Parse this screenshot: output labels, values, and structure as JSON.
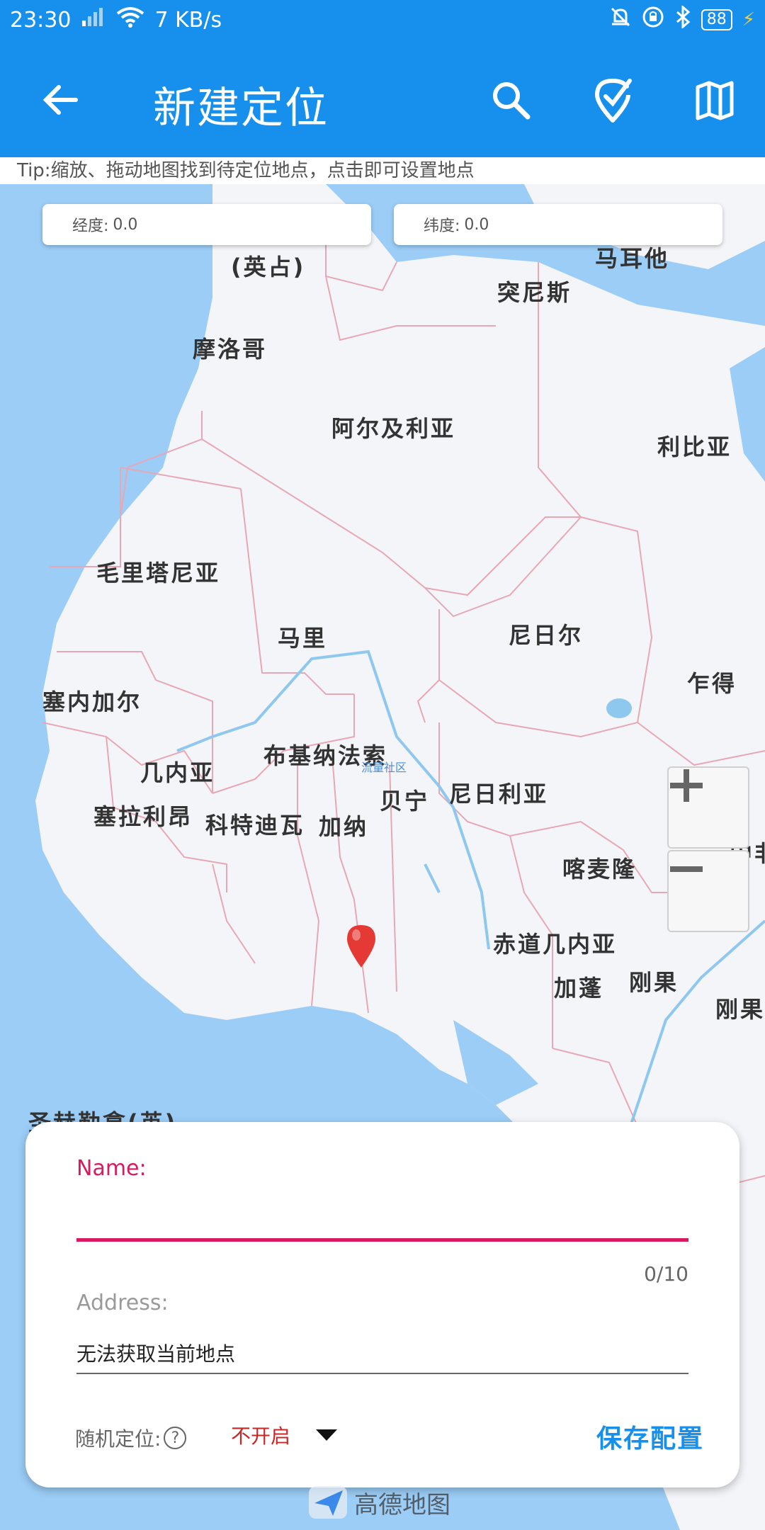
{
  "status_bar": {
    "time": "23:30",
    "speed": "7 KB/s",
    "battery": "88"
  },
  "app_bar": {
    "title": "新建定位"
  },
  "tip": "Tip:缩放、拖动地图找到待定位地点，点击即可设置地点",
  "coords": {
    "longitude_label": "经度:",
    "longitude_value": "0.0",
    "latitude_label": "纬度:",
    "latitude_value": "0.0"
  },
  "map_labels": [
    {
      "id": "ying-zhan",
      "text": "(英占)"
    },
    {
      "id": "malta",
      "text": "马耳他"
    },
    {
      "id": "tunisia",
      "text": "突尼斯"
    },
    {
      "id": "morocco",
      "text": "摩洛哥"
    },
    {
      "id": "algeria",
      "text": "阿尔及利亚"
    },
    {
      "id": "libya",
      "text": "利比亚"
    },
    {
      "id": "mauritania",
      "text": "毛里塔尼亚"
    },
    {
      "id": "mali",
      "text": "马里"
    },
    {
      "id": "niger",
      "text": "尼日尔"
    },
    {
      "id": "chad",
      "text": "乍得"
    },
    {
      "id": "senegal",
      "text": "塞内加尔"
    },
    {
      "id": "guinea",
      "text": "几内亚"
    },
    {
      "id": "burkina",
      "text": "布基纳法索"
    },
    {
      "id": "benin",
      "text": "贝宁"
    },
    {
      "id": "nigeria",
      "text": "尼日利亚"
    },
    {
      "id": "sierra-leone",
      "text": "塞拉利昂"
    },
    {
      "id": "ivory-coast",
      "text": "科特迪瓦"
    },
    {
      "id": "ghana",
      "text": "加纳"
    },
    {
      "id": "cameroon",
      "text": "喀麦隆"
    },
    {
      "id": "eq-guinea",
      "text": "赤道几内亚"
    },
    {
      "id": "gabon",
      "text": "加蓬"
    },
    {
      "id": "congo",
      "text": "刚果"
    },
    {
      "id": "congo-dr",
      "text": "刚果"
    },
    {
      "id": "central-african",
      "text": "中非"
    },
    {
      "id": "st-helena",
      "text": "圣赫勒拿(英)"
    }
  ],
  "map_watermark": "流量社区",
  "zoom": {
    "in_label": "+",
    "out_label": "−"
  },
  "form": {
    "name_label": "Name:",
    "name_value": "",
    "name_counter": "0/10",
    "address_label": "Address:",
    "address_value": "无法获取当前地点",
    "random_label": "随机定位:",
    "random_help": "?",
    "random_value": "不开启",
    "save_label": "保存配置"
  },
  "amap_logo": "高德地图",
  "colors": {
    "primary": "#1690ec",
    "accent": "#d81b60",
    "ocean": "#9bcdf6",
    "land": "#f4f5f9",
    "border": "#e8a7b5",
    "river": "#8ec8ee",
    "marker": "#e53935"
  }
}
